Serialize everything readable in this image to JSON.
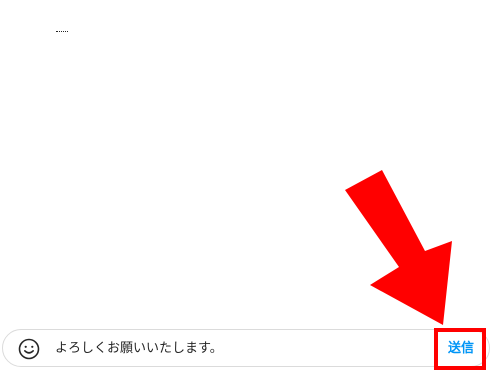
{
  "composer": {
    "emoji_icon": "smiley-face-icon",
    "message_value": "よろしくお願いいたします。",
    "send_label": "送信"
  },
  "annotation": {
    "arrow_icon": "red-arrow-icon",
    "highlight_color": "#ff0000"
  },
  "colors": {
    "send_text": "#0095f6",
    "input_border": "#dbdbdb",
    "text": "#262626"
  }
}
